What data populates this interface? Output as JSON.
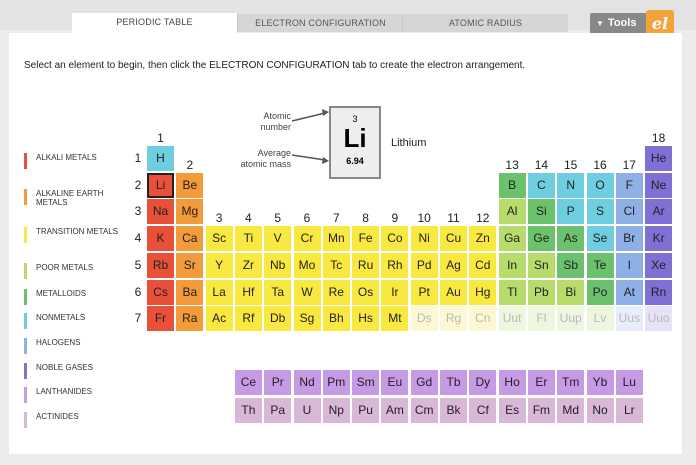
{
  "tabs": [
    {
      "label": "PERIODIC TABLE",
      "active": true
    },
    {
      "label": "ELECTRON CONFIGURATION",
      "active": false
    },
    {
      "label": "ATOMIC RADIUS",
      "active": false
    }
  ],
  "tools_label": "Tools",
  "logo_text": "el",
  "instruction": "Select an element to begin, then click the ELECTRON CONFIGURATION tab to create the electron arrangement.",
  "legend": [
    {
      "label": "ALKALI METALS",
      "color": "#e8503a"
    },
    {
      "label": "ALKALINE EARTH METALS",
      "color": "#f39a3a"
    },
    {
      "label": "TRANSITION METALS",
      "color": "#f8e840"
    },
    {
      "label": "POOR METALS",
      "color": "#b8dc6c"
    },
    {
      "label": "METALLOIDS",
      "color": "#6cc16c"
    },
    {
      "label": "NONMETALS",
      "color": "#6fcde0"
    },
    {
      "label": "HALOGENS",
      "color": "#8fb0e6"
    },
    {
      "label": "NOBLE GASES",
      "color": "#7f70d6"
    },
    {
      "label": "LANTHANIDES",
      "color": "#c79ae6"
    },
    {
      "label": "ACTINIDES",
      "color": "#d8b8d6"
    }
  ],
  "selected": {
    "number": "3",
    "symbol": "Li",
    "mass": "6.94",
    "name": "Lithium",
    "label_atomic_number": "Atomic number",
    "label_average_mass": "Average atomic mass"
  },
  "group_labels": [
    "1",
    "2",
    "3",
    "4",
    "5",
    "6",
    "7",
    "8",
    "9",
    "10",
    "11",
    "12",
    "13",
    "14",
    "15",
    "16",
    "17",
    "18"
  ],
  "period_labels": [
    "1",
    "2",
    "3",
    "4",
    "5",
    "6",
    "7"
  ],
  "rows": [
    [
      "H",
      "",
      "",
      "",
      "",
      "",
      "",
      "",
      "",
      "",
      "",
      "",
      "",
      "",
      "",
      "",
      "",
      "He"
    ],
    [
      "Li",
      "Be",
      "",
      "",
      "",
      "",
      "",
      "",
      "",
      "",
      "",
      "",
      "B",
      "C",
      "N",
      "O",
      "F",
      "Ne"
    ],
    [
      "Na",
      "Mg",
      "",
      "",
      "",
      "",
      "",
      "",
      "",
      "",
      "",
      "",
      "Al",
      "Si",
      "P",
      "S",
      "Cl",
      "Ar"
    ],
    [
      "K",
      "Ca",
      "Sc",
      "Ti",
      "V",
      "Cr",
      "Mn",
      "Fe",
      "Co",
      "Ni",
      "Cu",
      "Zn",
      "Ga",
      "Ge",
      "As",
      "Se",
      "Br",
      "Kr"
    ],
    [
      "Rb",
      "Sr",
      "Y",
      "Zr",
      "Nb",
      "Mo",
      "Tc",
      "Ru",
      "Rh",
      "Pd",
      "Ag",
      "Cd",
      "In",
      "Sn",
      "Sb",
      "Te",
      "I",
      "Xe"
    ],
    [
      "Cs",
      "Ba",
      "La",
      "Hf",
      "Ta",
      "W",
      "Re",
      "Os",
      "Ir",
      "Pt",
      "Au",
      "Hg",
      "Tl",
      "Pb",
      "Bi",
      "Po",
      "At",
      "Rn"
    ],
    [
      "Fr",
      "Ra",
      "Ac",
      "Rf",
      "Db",
      "Sg",
      "Bh",
      "Hs",
      "Mt",
      "Ds",
      "Rg",
      "Cn",
      "Uut",
      "Fl",
      "Uup",
      "Lv",
      "Uus",
      "Uuo"
    ]
  ],
  "row_types": [
    [
      "non",
      "",
      "",
      "",
      "",
      "",
      "",
      "",
      "",
      "",
      "",
      "",
      "",
      "",
      "",
      "",
      "",
      "ng"
    ],
    [
      "alk",
      "ae",
      "",
      "",
      "",
      "",
      "",
      "",
      "",
      "",
      "",
      "",
      "mt",
      "non",
      "non",
      "non",
      "hal",
      "ng"
    ],
    [
      "alk",
      "ae",
      "",
      "",
      "",
      "",
      "",
      "",
      "",
      "",
      "",
      "",
      "pm",
      "mt",
      "non",
      "non",
      "hal",
      "ng"
    ],
    [
      "alk",
      "ae",
      "tr",
      "tr",
      "tr",
      "tr",
      "tr",
      "tr",
      "tr",
      "tr",
      "tr",
      "tr",
      "pm",
      "mt",
      "mt",
      "non",
      "hal",
      "ng"
    ],
    [
      "alk",
      "ae",
      "tr",
      "tr",
      "tr",
      "tr",
      "tr",
      "tr",
      "tr",
      "tr",
      "tr",
      "tr",
      "pm",
      "pm",
      "mt",
      "mt",
      "hal",
      "ng"
    ],
    [
      "alk",
      "ae",
      "tr",
      "tr",
      "tr",
      "tr",
      "tr",
      "tr",
      "tr",
      "tr",
      "tr",
      "tr",
      "pm",
      "pm",
      "pm",
      "mt",
      "hal",
      "ng"
    ],
    [
      "alk",
      "ae",
      "tr",
      "tr",
      "tr",
      "tr",
      "tr",
      "tr",
      "tr",
      "utr",
      "utr",
      "utr",
      "upm",
      "upm",
      "upm",
      "upm",
      "uhal",
      "ung"
    ]
  ],
  "lanthanides": [
    "Ce",
    "Pr",
    "Nd",
    "Pm",
    "Sm",
    "Eu",
    "Gd",
    "Tb",
    "Dy",
    "Ho",
    "Er",
    "Tm",
    "Yb",
    "Lu"
  ],
  "actinides": [
    "Th",
    "Pa",
    "U",
    "Np",
    "Pu",
    "Am",
    "Cm",
    "Bk",
    "Cf",
    "Es",
    "Fm",
    "Md",
    "No",
    "Lr"
  ],
  "colors": {
    "alk": "#e8503a",
    "ae": "#f39a3a",
    "tr": "#f8e840",
    "pm": "#b8dc6c",
    "mt": "#6cc16c",
    "non": "#6fcde0",
    "hal": "#8fb0e6",
    "ng": "#7f70d6",
    "lan": "#c79ae6",
    "act": "#d8b8d6",
    "utr": "#fdf8d4",
    "upm": "#eef6df",
    "uhal": "#e6eefb",
    "ung": "#e6e2f8"
  }
}
